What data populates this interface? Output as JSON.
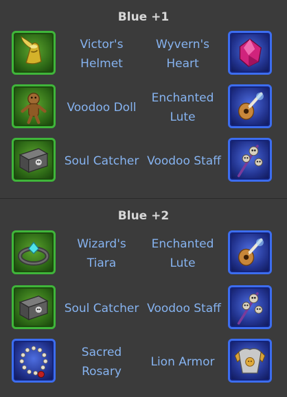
{
  "sections": [
    {
      "title": "Blue +1",
      "rows": [
        {
          "left": {
            "name": "Victor's Helmet",
            "line1": "Victor's",
            "line2": "Helmet",
            "icon": "golden-winged-helmet-icon"
          },
          "right": {
            "name": "Wyvern's Heart",
            "line1": "Wyvern's",
            "line2": "Heart",
            "icon": "crimson-gem-icon"
          }
        },
        {
          "left": {
            "name": "Voodoo Doll",
            "line1": "Voodoo Doll",
            "line2": "",
            "icon": "voodoo-doll-icon"
          },
          "right": {
            "name": "Enchanted Lute",
            "line1": "Enchanted",
            "line2": "Lute",
            "icon": "lute-icon"
          }
        },
        {
          "left": {
            "name": "Soul Catcher",
            "line1": "Soul Catcher",
            "line2": "",
            "icon": "skull-chest-icon"
          },
          "right": {
            "name": "Voodoo Staff",
            "line1": "Voodoo Staff",
            "line2": "",
            "icon": "skull-staff-icon"
          }
        }
      ]
    },
    {
      "title": "Blue +2",
      "rows": [
        {
          "left": {
            "name": "Wizard's Tiara",
            "line1": "Wizard's",
            "line2": "Tiara",
            "icon": "tiara-icon"
          },
          "right": {
            "name": "Enchanted Lute",
            "line1": "Enchanted",
            "line2": "Lute",
            "icon": "lute-icon"
          }
        },
        {
          "left": {
            "name": "Soul Catcher",
            "line1": "Soul Catcher",
            "line2": "",
            "icon": "skull-chest-icon"
          },
          "right": {
            "name": "Voodoo Staff",
            "line1": "Voodoo Staff",
            "line2": "",
            "icon": "skull-staff-icon"
          }
        },
        {
          "left": {
            "name": "Sacred Rosary",
            "line1": "Sacred",
            "line2": "Rosary",
            "icon": "rosary-icon"
          },
          "right": {
            "name": "Lion Armor",
            "line1": "Lion Armor",
            "line2": "",
            "icon": "lion-armor-icon"
          }
        }
      ]
    }
  ],
  "colors": {
    "background": "#3b3b3b",
    "title": "#d8d8d8",
    "item_text": "#86b3f0",
    "green_frame": "#3fb63a",
    "blue_frame": "#3c6df0"
  }
}
